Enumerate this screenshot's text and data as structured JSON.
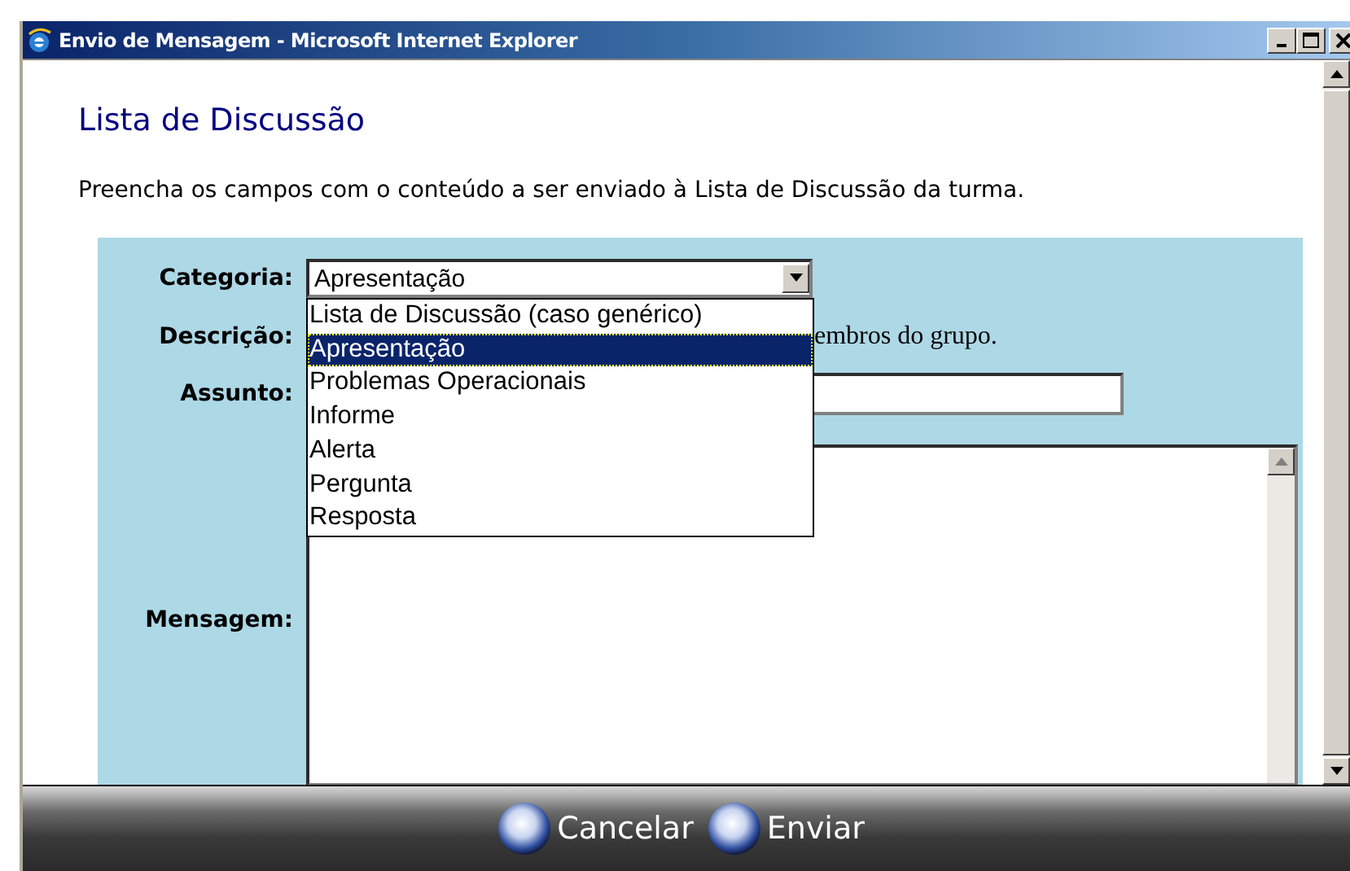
{
  "window": {
    "title": "Envio de Mensagem - Microsoft Internet Explorer"
  },
  "heading": "Lista de Discussão",
  "intro": "Preencha os campos com o conteúdo a ser enviado à Lista de Discussão da turma.",
  "form": {
    "fields": [
      {
        "kind": "select",
        "label": "Categoria:",
        "value": "Apresentação",
        "expanded": true,
        "options": [
          {
            "label": "Lista de Discussão (caso genérico)",
            "selected": false
          },
          {
            "label": "Apresentação",
            "selected": true
          },
          {
            "label": "Problemas Operacionais",
            "selected": false
          },
          {
            "label": "Informe",
            "selected": false
          },
          {
            "label": "Alerta",
            "selected": false
          },
          {
            "label": "Pergunta",
            "selected": false
          },
          {
            "label": "Resposta",
            "selected": false
          }
        ]
      },
      {
        "kind": "static",
        "label": "Descrição:",
        "value": "embros do grupo."
      },
      {
        "kind": "input",
        "label": "Assunto:"
      },
      {
        "kind": "textarea",
        "label": "Mensagem:"
      }
    ]
  },
  "buttons": [
    "Cancelar",
    "Enviar"
  ]
}
